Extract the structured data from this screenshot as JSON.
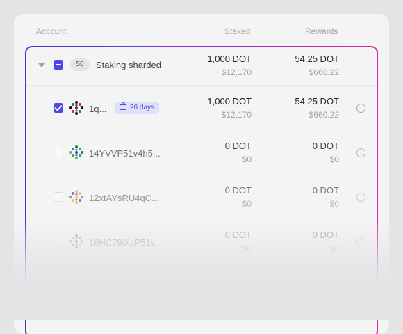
{
  "header": {
    "account": "Account",
    "staked": "Staked",
    "rewards": "Rewards"
  },
  "colors": {
    "accent": "#4f46e5",
    "gradient_start": "#3b3bd6",
    "gradient_end": "#e0249a"
  },
  "group": {
    "count": "50",
    "name": "Staking sharded",
    "staked": "1,000 DOT",
    "staked_fiat": "$12,170",
    "rewards": "54.25 DOT",
    "rewards_fiat": "$660.22",
    "checkbox_state": "indeterminate"
  },
  "accounts": [
    {
      "address": "1q...",
      "badge": "26 days",
      "staked": "1,000 DOT",
      "staked_fiat": "$12,170",
      "rewards": "54.25 DOT",
      "rewards_fiat": "$660.22",
      "checked": true,
      "info_icon": "info-icon"
    },
    {
      "address": "14YVVP51v4h5...",
      "staked": "0 DOT",
      "staked_fiat": "$0",
      "rewards": "0 DOT",
      "rewards_fiat": "$0",
      "checked": false,
      "info_icon": "info-icon"
    },
    {
      "address": "12xtAYsRU4qC...",
      "staked": "0 DOT",
      "staked_fiat": "$0",
      "rewards": "0 DOT",
      "rewards_fiat": "$0",
      "checked": false,
      "info_icon": "info-icon"
    },
    {
      "address": "16HC79iXzP51v...",
      "staked": "0 DOT",
      "staked_fiat": "$0",
      "rewards": "0 DOT",
      "rewards_fiat": "$0",
      "checked": false,
      "info_icon": "info-icon"
    }
  ]
}
